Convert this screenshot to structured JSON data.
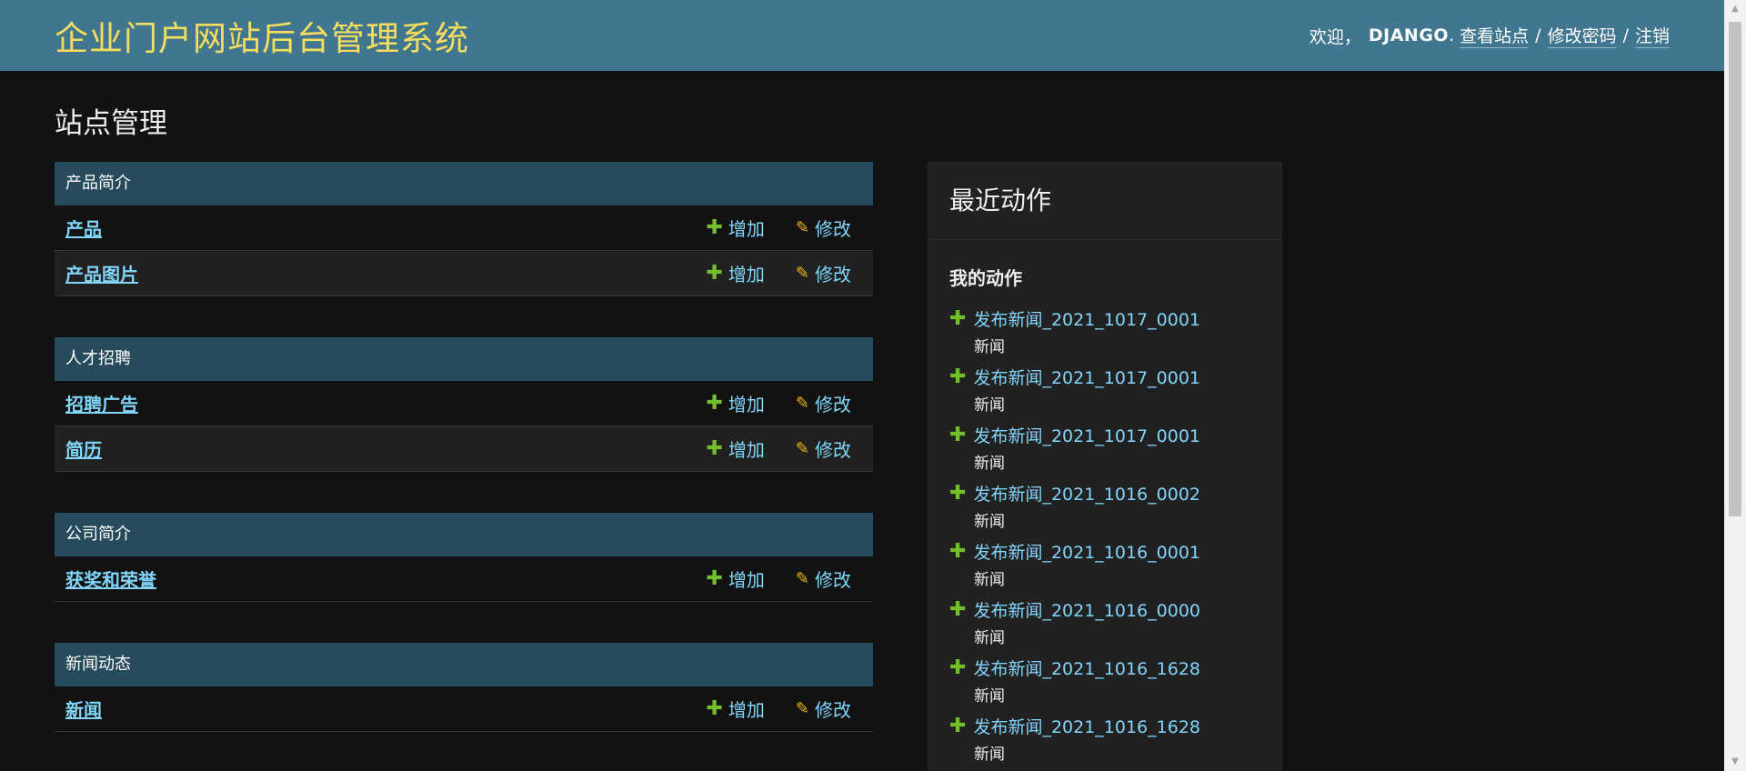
{
  "header": {
    "site_name": "企业门户网站后台管理系统",
    "welcome": "欢迎，",
    "username": "DJANGO",
    "username_suffix": ".",
    "view_site": "查看站点",
    "change_password": "修改密码",
    "logout": "注销",
    "separator": "/"
  },
  "page_title": "站点管理",
  "modules": [
    {
      "caption": "产品简介",
      "models": [
        {
          "name": "产品",
          "add": "增加",
          "change": "修改"
        },
        {
          "name": "产品图片",
          "add": "增加",
          "change": "修改"
        }
      ]
    },
    {
      "caption": "人才招聘",
      "models": [
        {
          "name": "招聘广告",
          "add": "增加",
          "change": "修改"
        },
        {
          "name": "简历",
          "add": "增加",
          "change": "修改"
        }
      ]
    },
    {
      "caption": "公司简介",
      "models": [
        {
          "name": "获奖和荣誉",
          "add": "增加",
          "change": "修改"
        }
      ]
    },
    {
      "caption": "新闻动态",
      "models": [
        {
          "name": "新闻",
          "add": "增加",
          "change": "修改"
        }
      ]
    }
  ],
  "recent_actions": {
    "title": "最近动作",
    "subtitle": "我的动作",
    "items": [
      {
        "title": "发布新闻_2021_1017_0001",
        "type": "新闻"
      },
      {
        "title": "发布新闻_2021_1017_0001",
        "type": "新闻"
      },
      {
        "title": "发布新闻_2021_1017_0001",
        "type": "新闻"
      },
      {
        "title": "发布新闻_2021_1016_0002",
        "type": "新闻"
      },
      {
        "title": "发布新闻_2021_1016_0001",
        "type": "新闻"
      },
      {
        "title": "发布新闻_2021_1016_0000",
        "type": "新闻"
      },
      {
        "title": "发布新闻_2021_1016_1628",
        "type": "新闻"
      },
      {
        "title": "发布新闻_2021_1016_1628",
        "type": "新闻"
      }
    ]
  },
  "icons": {
    "add": "plus-icon",
    "change": "pencil-icon",
    "scroll_up": "arrow-up-icon",
    "scroll_down": "arrow-down-icon"
  },
  "colors": {
    "header_bg": "#417690",
    "site_name": "#f5dd5d",
    "caption_bg": "#264b5d",
    "link": "#81d4fa",
    "add_icon": "#70bf2b",
    "change_icon": "#efb80b",
    "page_bg": "#121212"
  }
}
